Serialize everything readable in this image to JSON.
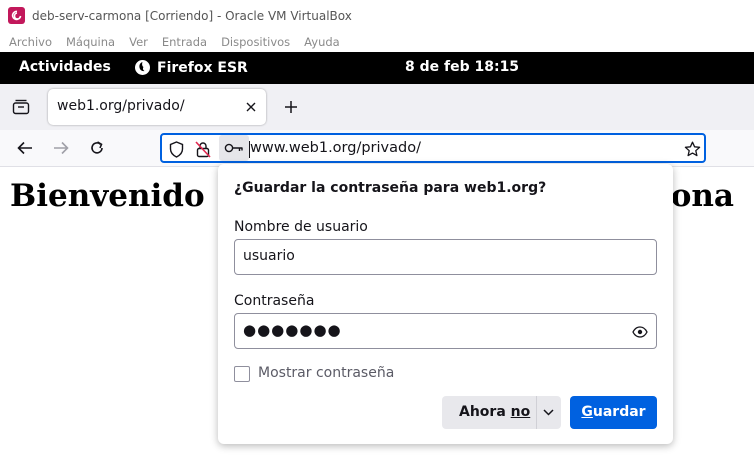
{
  "vbox": {
    "title": "deb-serv-carmona [Corriendo] - Oracle VM VirtualBox",
    "menu": [
      "Archivo",
      "Máquina",
      "Ver",
      "Entrada",
      "Dispositivos",
      "Ayuda"
    ]
  },
  "gnome": {
    "activities": "Actividades",
    "app_name": "Firefox ESR",
    "clock": "8 de feb  18:15"
  },
  "browser": {
    "tab_title": "web1.org/privado/",
    "url": "www.web1.org/privado/",
    "accent_color": "#0061e0"
  },
  "page": {
    "heading_start": "Bienvenido",
    "heading_end": "ona"
  },
  "password_prompt": {
    "title": "¿Guardar la contraseña para web1.org?",
    "username_label": "Nombre de usuario",
    "username_value": "usuario",
    "password_label": "Contraseña",
    "password_mask": "●●●●●●●",
    "show_password_label": "Mostrar contraseña",
    "not_now_pre": "Ahora ",
    "not_now_key": "no",
    "save_key": "G",
    "save_rest": "uardar"
  }
}
